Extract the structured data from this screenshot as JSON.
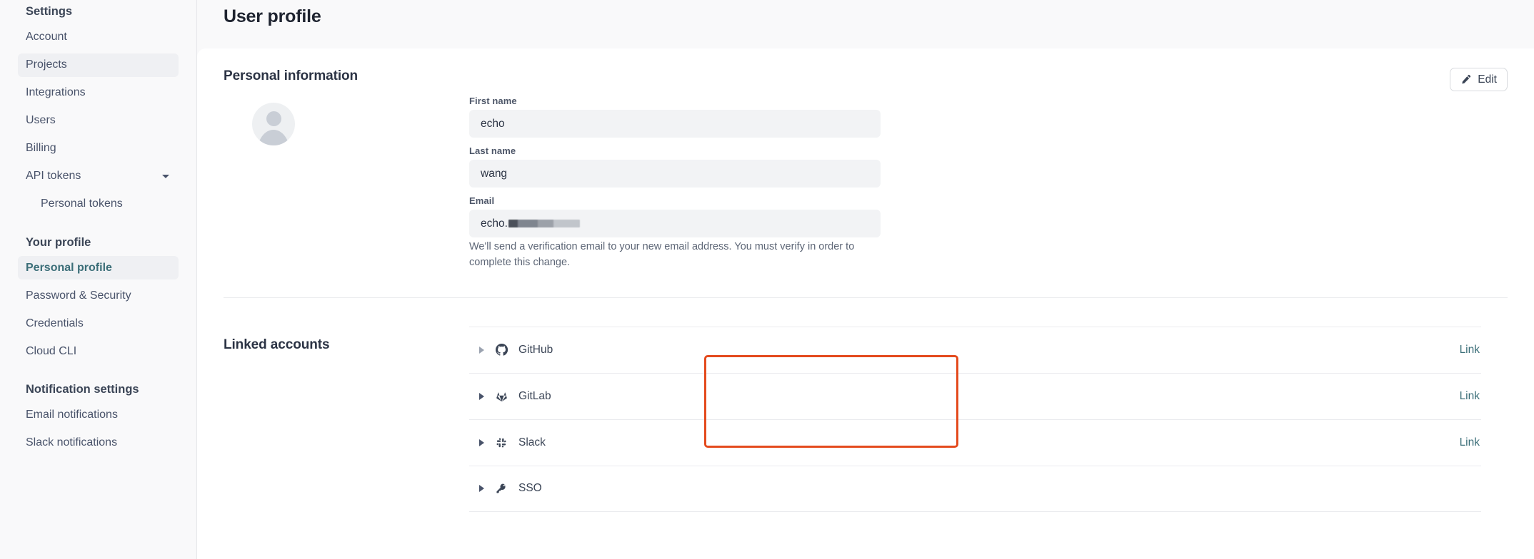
{
  "page": {
    "title": "User profile"
  },
  "sidebar": {
    "groups": [
      {
        "title": "Settings",
        "items": [
          {
            "label": "Account",
            "state": "default",
            "icon": ""
          },
          {
            "label": "Projects",
            "state": "active",
            "icon": ""
          },
          {
            "label": "Integrations",
            "state": "default",
            "icon": ""
          },
          {
            "label": "Users",
            "state": "default",
            "icon": ""
          },
          {
            "label": "Billing",
            "state": "default",
            "icon": ""
          },
          {
            "label": "API tokens",
            "state": "default",
            "icon": "chevron-down-icon"
          },
          {
            "label": "Personal tokens",
            "state": "sub",
            "icon": ""
          }
        ]
      },
      {
        "title": "Your profile",
        "items": [
          {
            "label": "Personal profile",
            "state": "active-teal",
            "icon": ""
          },
          {
            "label": "Password & Security",
            "state": "default",
            "icon": ""
          },
          {
            "label": "Credentials",
            "state": "default",
            "icon": ""
          },
          {
            "label": "Cloud CLI",
            "state": "default",
            "icon": ""
          }
        ]
      },
      {
        "title": "Notification settings",
        "items": [
          {
            "label": "Email notifications",
            "state": "default",
            "icon": ""
          },
          {
            "label": "Slack notifications",
            "state": "default",
            "icon": ""
          }
        ]
      }
    ]
  },
  "personal_information": {
    "section_title": "Personal information",
    "edit_label": "Edit",
    "edit_icon": "pencil-icon",
    "avatar_icon": "user-avatar-placeholder",
    "fields": [
      {
        "label": "First name",
        "value": "echo",
        "placeholder": "First name"
      },
      {
        "label": "Last name",
        "value": "wang",
        "placeholder": "Last name"
      },
      {
        "label": "Email",
        "value": "echo.",
        "placeholder": "Email",
        "redacted": true
      }
    ],
    "email_help": "We'll send a verification email to your new email address. You must verify in order to complete this change."
  },
  "linked_accounts": {
    "section_title": "Linked accounts",
    "rows": [
      {
        "label": "GitHub",
        "icon": "github-icon",
        "action": "Link",
        "caret": "expand-caret-icon"
      },
      {
        "label": "GitLab",
        "icon": "gitlab-icon",
        "action": "Link",
        "caret": "expand-caret-icon"
      },
      {
        "label": "Slack",
        "icon": "slack-icon",
        "action": "Link",
        "caret": "expand-caret-icon"
      },
      {
        "label": "SSO",
        "icon": "key-icon",
        "action": "",
        "caret": "expand-caret-icon"
      }
    ]
  },
  "annotation": {
    "highlight_color": "#e44a1d",
    "highlight_target": "github-and-gitlab-rows"
  },
  "colors": {
    "accent_teal": "#3b6e78",
    "sidebar_bg": "#f9f9fa",
    "card_bg": "#ffffff",
    "input_bg": "#f2f3f5",
    "divider": "#eaebee",
    "highlight": "#e44a1d"
  }
}
